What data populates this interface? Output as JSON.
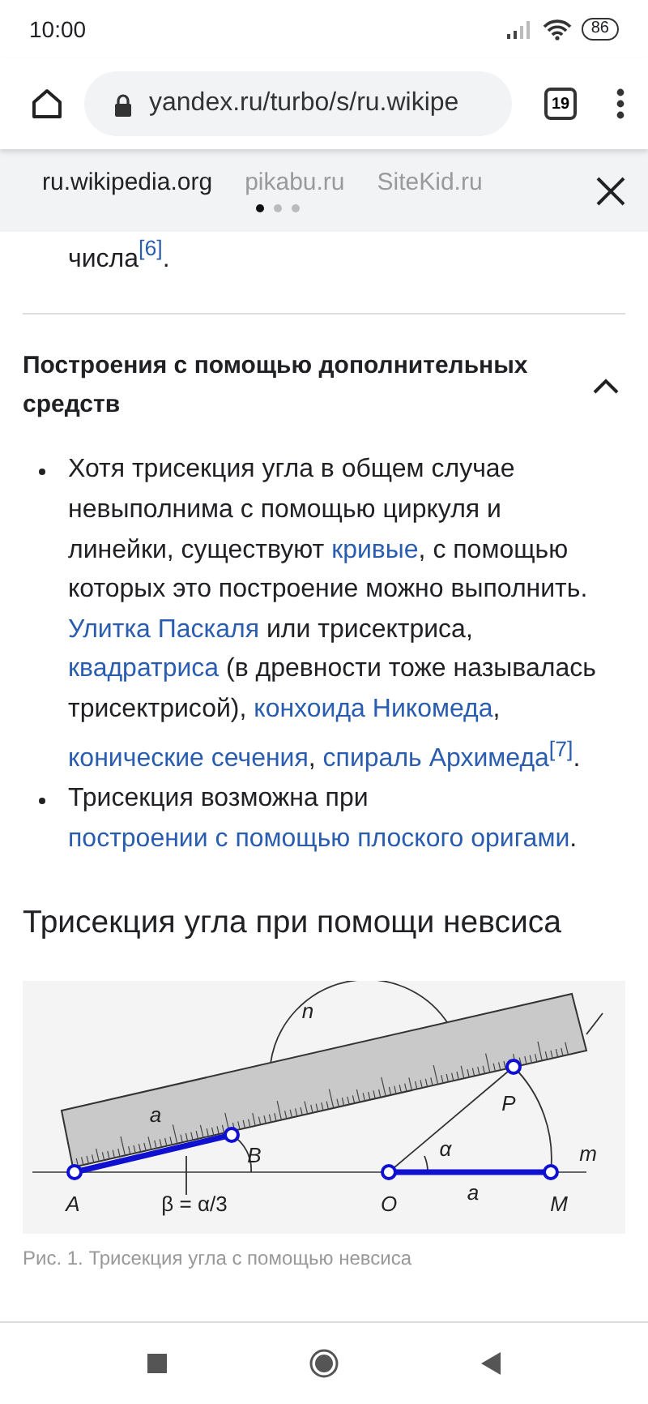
{
  "status_bar": {
    "time": "10:00",
    "battery": "86"
  },
  "browser": {
    "url": "yandex.ru/turbo/s/ru.wikipe",
    "tab_count": "19"
  },
  "site_tabs": [
    {
      "label": "ru.wikipedia.org",
      "selected": true
    },
    {
      "label": "pikabu.ru",
      "selected": false
    },
    {
      "label": "SiteKid.ru",
      "selected": false
    }
  ],
  "top_fragment": [
    {
      "text": "числа",
      "kind": "text"
    },
    {
      "text": "$^{[6]}$",
      "kind": "link"
    },
    {
      "text": ".",
      "kind": "text"
    }
  ],
  "section": {
    "title": "Построения с помощью дополнительных средств",
    "expanded": true
  },
  "bullets": [
    [
      {
        "text": "Хотя трисекция угла в общем случае невыполнима с помощью циркуля и линейки, существуют ",
        "kind": "text"
      },
      {
        "text": "кривые",
        "kind": "link"
      },
      {
        "text": ", с помощью которых это построение можно выполнить. ",
        "kind": "text"
      },
      {
        "text": "Улитка Паскаля",
        "kind": "link"
      },
      {
        "text": " или трисектриса, ",
        "kind": "text"
      },
      {
        "text": "квадратриса",
        "kind": "link"
      },
      {
        "text": " (в древности тоже называлась трисектрисой), ",
        "kind": "text"
      },
      {
        "text": "конхоида Никомеда",
        "kind": "link"
      },
      {
        "text": ", ",
        "kind": "text"
      },
      {
        "text": "конические сечения",
        "kind": "link"
      },
      {
        "text": ", ",
        "kind": "text"
      },
      {
        "text": "спираль Архимеда",
        "kind": "link"
      },
      {
        "text": "$^{[7]}$",
        "kind": "link"
      },
      {
        "text": ".",
        "kind": "text"
      }
    ],
    [
      {
        "text": "Трисекция возможна при ",
        "kind": "text"
      },
      {
        "text": "построении с ",
        "kind": "link"
      },
      {
        "text": "помощью плоского оригами",
        "kind": "link"
      },
      {
        "text": ".",
        "kind": "text"
      }
    ]
  ],
  "heading": "Трисекция угла при помощи невсиса",
  "figure": {
    "labels": [
      "n",
      "a",
      "B",
      "A",
      "β = α/3",
      "P",
      "α",
      "m",
      "O",
      "a",
      "M"
    ],
    "caption": "Рис. 1. Трисекция угла с помощью невсиса"
  }
}
